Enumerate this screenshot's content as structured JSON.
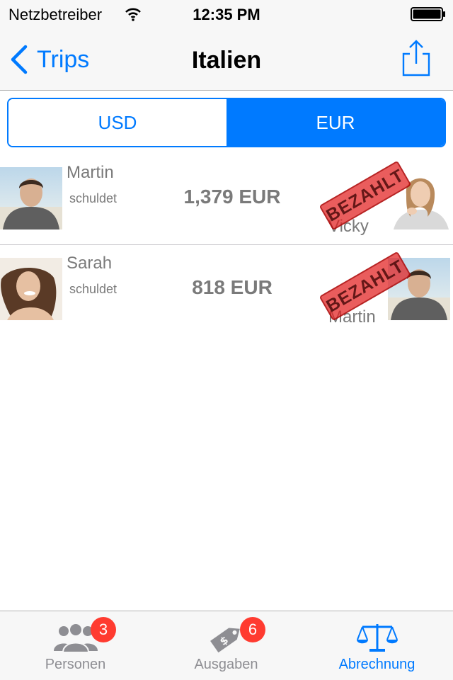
{
  "status_bar": {
    "carrier": "Netzbetreiber",
    "time": "12:35 PM"
  },
  "nav": {
    "back_label": "Trips",
    "title": "Italien"
  },
  "currency_toggle": {
    "options": [
      "USD",
      "EUR"
    ],
    "selected": "EUR"
  },
  "debts": [
    {
      "debtor": "Martin",
      "owes_label": "schuldet",
      "amount": "1,379 EUR",
      "creditor": "Vicky",
      "stamp": "BEZAHLT"
    },
    {
      "debtor": "Sarah",
      "owes_label": "schuldet",
      "amount": "818 EUR",
      "creditor": "Martin",
      "stamp": "BEZAHLT"
    }
  ],
  "tabs": [
    {
      "label": "Personen",
      "badge": "3",
      "icon": "people-icon"
    },
    {
      "label": "Ausgaben",
      "badge": "6",
      "icon": "price-tag-icon"
    },
    {
      "label": "Abrechnung",
      "badge": "",
      "icon": "scales-icon",
      "active": true
    }
  ],
  "colors": {
    "accent": "#007aff",
    "badge": "#ff3b30",
    "stamp": "#e21e1e"
  }
}
